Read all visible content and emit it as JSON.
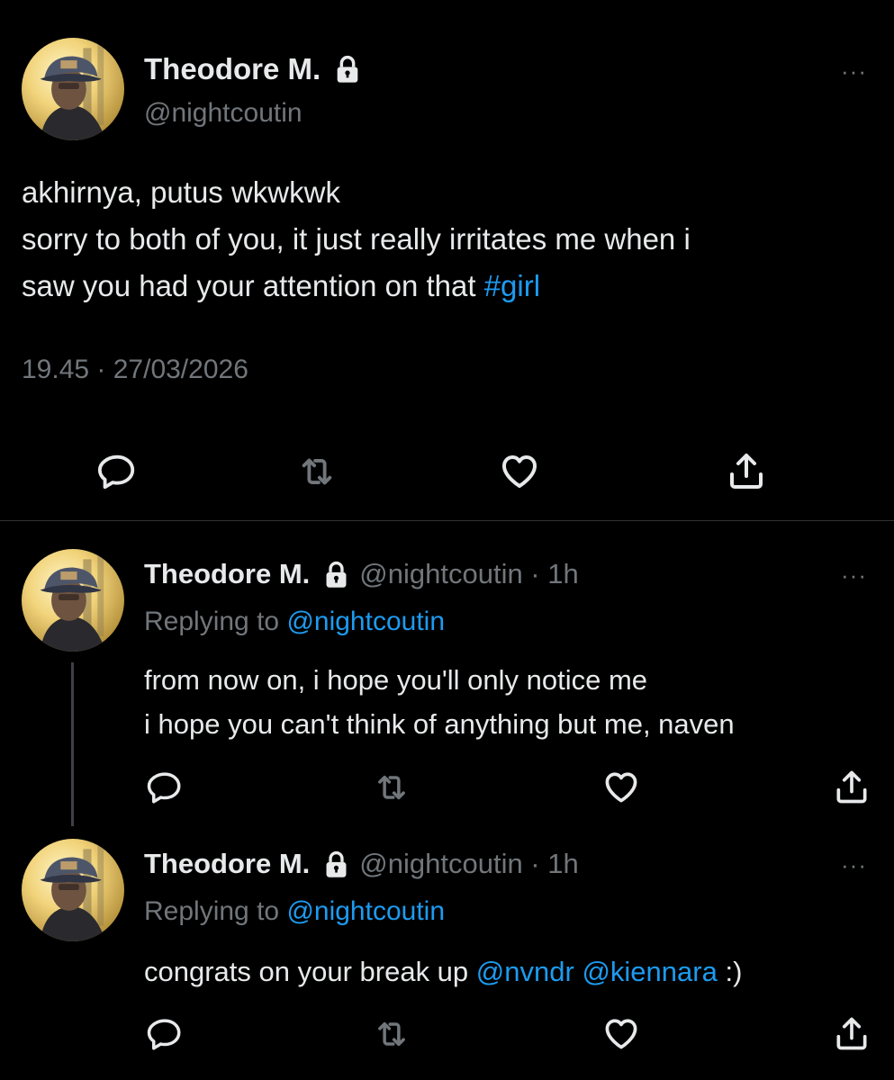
{
  "main_tweet": {
    "display_name": "Theodore M.",
    "handle": "@nightcoutin",
    "text_lines": [
      "akhirnya, putus wkwkwk",
      "sorry to both of you, it just really irritates me when i",
      "saw you had your attention on that"
    ],
    "hashtag": "#girl",
    "timestamp": "19.45 · 27/03/2026"
  },
  "replies": [
    {
      "display_name": "Theodore M.",
      "handle_time": "@nightcoutin · 1h",
      "replying_prefix": "Replying to",
      "replying_handle": "@nightcoutin",
      "text_lines": [
        "from now on, i hope you'll only notice me",
        "i hope you can't think of anything but me, naven"
      ]
    },
    {
      "display_name": "Theodore M.",
      "handle_time": "@nightcoutin · 1h",
      "replying_prefix": "Replying to",
      "replying_handle": "@nightcoutin",
      "text_before": "congrats on your break up",
      "mention_1": "@nvndr",
      "mention_2": "@kiennara",
      "text_after": ":)"
    }
  ],
  "icons": {
    "reply": "comment-icon",
    "retweet": "retweet-icon",
    "like": "heart-icon",
    "share": "share-icon",
    "more": "more-icon",
    "protected": "lock-icon"
  },
  "more_glyph": "···",
  "colors": {
    "background": "#000000",
    "text": "#e7e9ea",
    "secondary": "#71767b",
    "link": "#1d9bf0",
    "divider": "#2f3336"
  }
}
